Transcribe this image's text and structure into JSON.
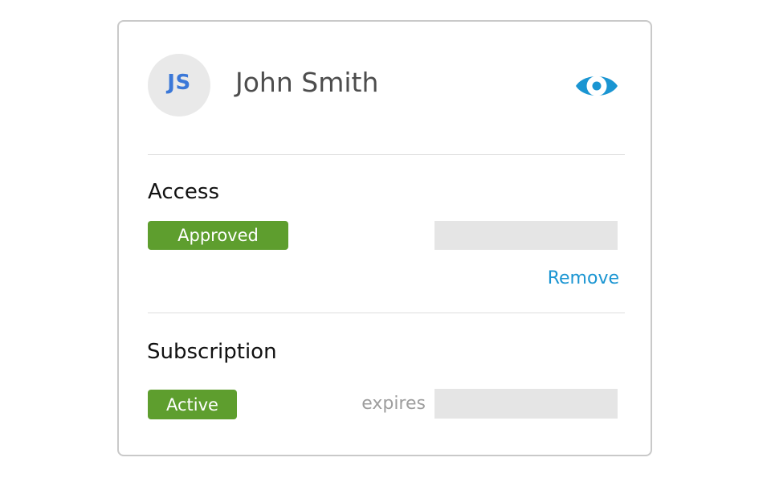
{
  "user": {
    "initials": "JS",
    "name": "John Smith"
  },
  "header": {
    "view_icon": "eye-icon"
  },
  "access": {
    "title": "Access",
    "status": "Approved",
    "remove_label": "Remove"
  },
  "subscription": {
    "title": "Subscription",
    "status": "Active",
    "expires_label": "expires"
  },
  "colors": {
    "initials": "#3b78d8",
    "badge_green": "#5e9e2e",
    "link_blue": "#1a95d2",
    "eye_blue": "#1a95d2",
    "placeholder_gray": "#e5e5e5"
  }
}
